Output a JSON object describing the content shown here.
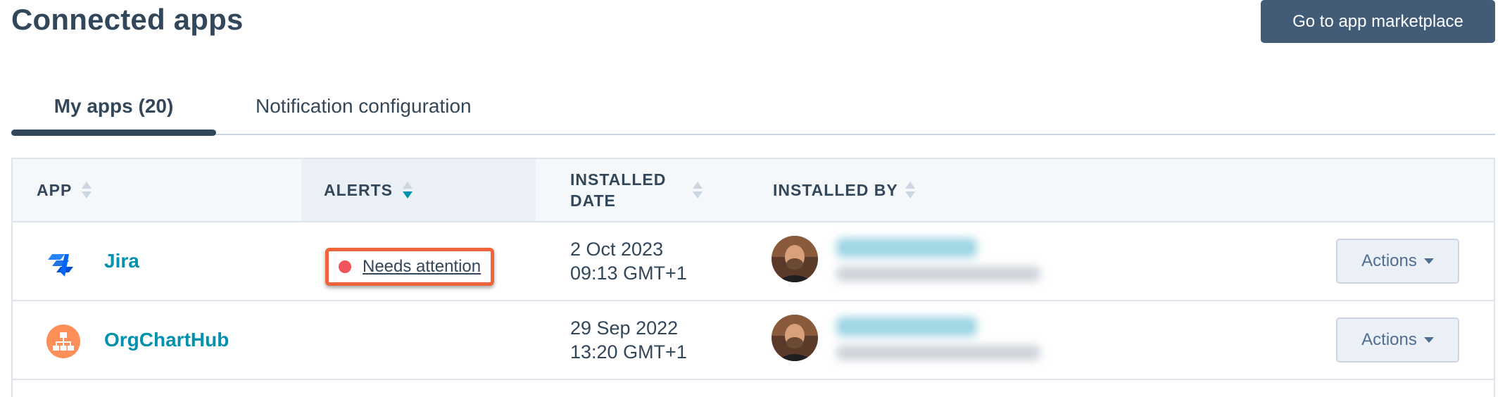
{
  "page": {
    "title": "Connected apps"
  },
  "header": {
    "marketplace_button": "Go to app marketplace"
  },
  "tabs": [
    {
      "label": "My apps (20)",
      "active": true
    },
    {
      "label": "Notification configuration",
      "active": false
    }
  ],
  "table": {
    "columns": {
      "app": "APP",
      "alerts": "ALERTS",
      "installed_date_line1": "INSTALLED",
      "installed_date_line2": "DATE",
      "installed_by": "INSTALLED BY"
    },
    "sorted_column": "ALERTS",
    "rows": [
      {
        "app": "Jira",
        "icon": "jira-icon",
        "alert": "Needs attention",
        "date": "2 Oct 2023",
        "time": "09:13 GMT+1",
        "actions": "Actions"
      },
      {
        "app": "OrgChartHub",
        "icon": "org-chart-icon",
        "alert": "",
        "date": "29 Sep 2022",
        "time": "13:20 GMT+1",
        "actions": "Actions"
      }
    ]
  },
  "colors": {
    "primary_text": "#33475b",
    "link": "#0091ae",
    "button_dark": "#425b76",
    "alert_highlight": "#f0643a",
    "alert_dot": "#f2545b",
    "orgchart_icon": "#ff8f59",
    "jira_icon": "#2684ff"
  }
}
